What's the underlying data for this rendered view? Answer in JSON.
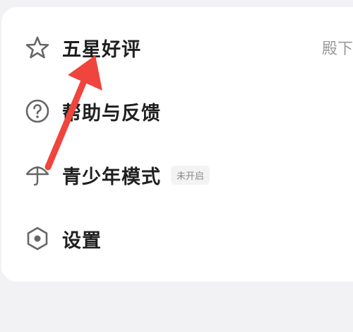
{
  "menu": {
    "items": [
      {
        "label": "五星好评",
        "trailing": "殿下",
        "icon": "star-icon"
      },
      {
        "label": "帮助与反馈",
        "icon": "help-icon"
      },
      {
        "label": "青少年模式",
        "badge": "未开启",
        "icon": "umbrella-icon"
      },
      {
        "label": "设置",
        "icon": "settings-icon"
      }
    ]
  },
  "colors": {
    "annotation_arrow": "#f0453c",
    "icon_stroke": "#666666",
    "card_background": "#ffffff",
    "page_background": "#f2f2f4"
  }
}
